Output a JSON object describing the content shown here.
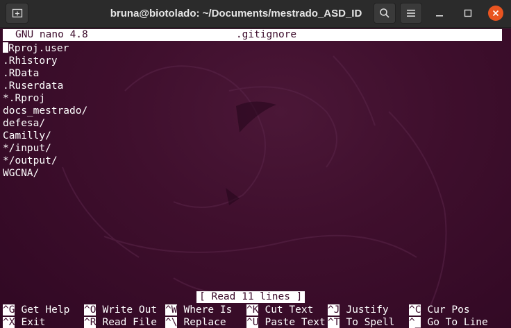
{
  "window": {
    "title": "bruna@biotolado: ~/Documents/mestrado_ASD_ID",
    "icons": {
      "new_tab": "new-tab-icon",
      "search": "search-icon",
      "menu": "hamburger-menu-icon",
      "minimize": "minimize-icon",
      "maximize": "maximize-icon",
      "close": "close-icon"
    },
    "close_color": "#e95420"
  },
  "nano": {
    "version": "GNU nano 4.8",
    "filename": ".gitignore",
    "lines": [
      ".Rproj.user",
      ".Rhistory",
      ".RData",
      ".Ruserdata",
      "*.Rproj",
      "docs_mestrado/",
      "defesa/",
      "Camilly/",
      "*/input/",
      "*/output/",
      "WGCNA/"
    ],
    "status": "[ Read 11 lines ]",
    "shortcuts": [
      [
        {
          "key": "^G",
          "label": "Get Help"
        },
        {
          "key": "^O",
          "label": "Write Out"
        },
        {
          "key": "^W",
          "label": "Where Is"
        },
        {
          "key": "^K",
          "label": "Cut Text"
        },
        {
          "key": "^J",
          "label": "Justify"
        },
        {
          "key": "^C",
          "label": "Cur Pos"
        }
      ],
      [
        {
          "key": "^X",
          "label": "Exit"
        },
        {
          "key": "^R",
          "label": "Read File"
        },
        {
          "key": "^\\",
          "label": "Replace"
        },
        {
          "key": "^U",
          "label": "Paste Text"
        },
        {
          "key": "^T",
          "label": "To Spell"
        },
        {
          "key": "^_",
          "label": "Go To Line"
        }
      ]
    ],
    "colors": {
      "background": "#300a24",
      "text": "#ffffff",
      "inverse_text": "#3b0a2a"
    }
  }
}
